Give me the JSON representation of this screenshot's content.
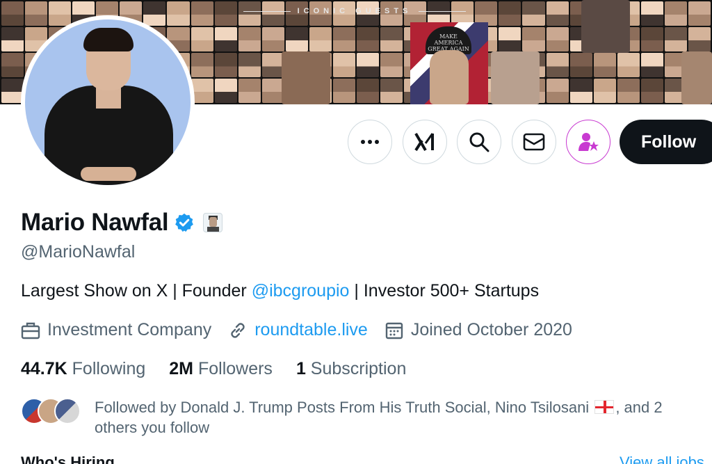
{
  "banner": {
    "title": "ICONIC GUESTS",
    "hat_text": "MAKE AMERICA GREAT AGAIN"
  },
  "profile": {
    "name": "Mario Nawfal",
    "handle": "@MarioNawfal",
    "bio_prefix": "Largest Show on X | Founder ",
    "bio_link": "@ibcgroupio",
    "bio_suffix": " | Investor 500+ Startups",
    "category": "Investment Company",
    "website": "roundtable.live",
    "joined": "Joined October 2020"
  },
  "actions": {
    "more_icon": "more-icon",
    "grok_icon": "grok-icon",
    "search_icon": "search-icon",
    "message_icon": "mail-icon",
    "subscribe_icon": "subscribe-icon",
    "follow_label": "Follow"
  },
  "stats": {
    "following_count": "44.7K",
    "following_label": " Following",
    "followers_count": "2M",
    "followers_label": " Followers",
    "subscription_count": "1",
    "subscription_label": " Subscription"
  },
  "followed_by": {
    "text_before_flag": "Followed by Donald J. Trump Posts From His Truth Social, Nino Tsilosani ",
    "text_after_flag": ", and 2 others you follow"
  },
  "next_section": {
    "title": "Who's Hiring",
    "link": "View all jobs"
  },
  "colors": {
    "accent": "#1d9bf0",
    "subscribe": "#c83ad1",
    "text_primary": "#0f1419",
    "text_secondary": "#536471",
    "border": "#cfd9de"
  }
}
